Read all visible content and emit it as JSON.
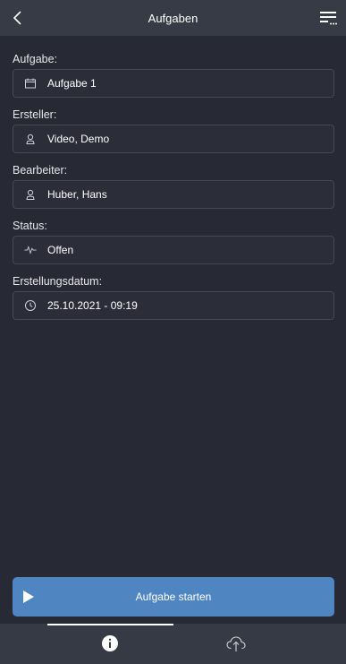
{
  "header": {
    "title": "Aufgaben"
  },
  "fields": {
    "task": {
      "label": "Aufgabe:",
      "value": "Aufgabe 1"
    },
    "creator": {
      "label": "Ersteller:",
      "value": "Video, Demo"
    },
    "editor": {
      "label": "Bearbeiter:",
      "value": "Huber, Hans"
    },
    "status": {
      "label": "Status:",
      "value": "Offen"
    },
    "created": {
      "label": "Erstellungsdatum:",
      "value": "25.10.2021 - 09:19"
    }
  },
  "actions": {
    "start_label": "Aufgabe starten"
  },
  "colors": {
    "background": "#272a35",
    "header": "#373b45",
    "accent": "#4f86c2"
  }
}
